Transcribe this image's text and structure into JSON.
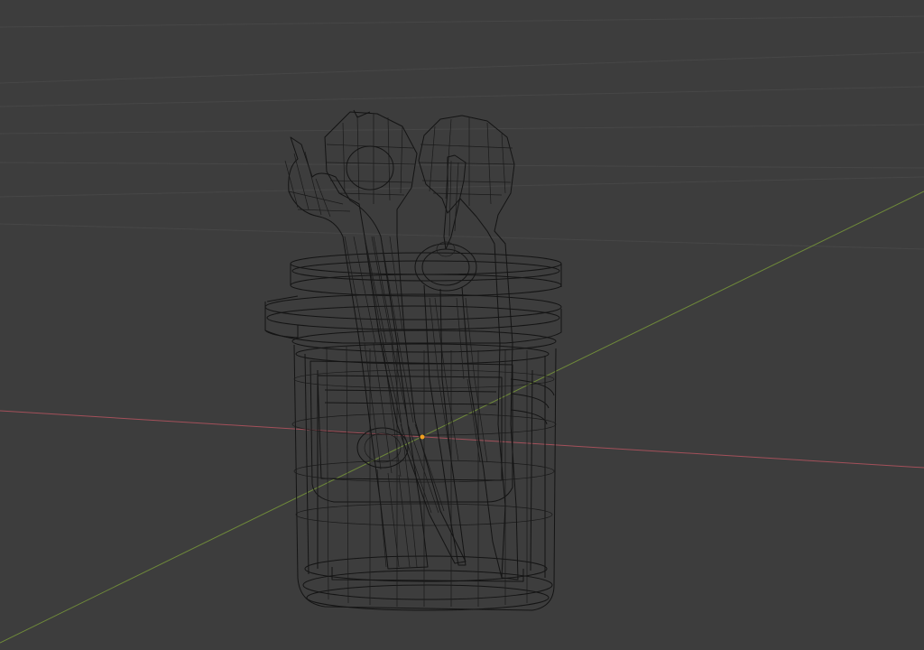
{
  "viewport": {
    "mode": "wireframe",
    "background_color": "#3d3d3d",
    "wire_color": "#141414",
    "x_axis_color": "#a3505a",
    "y_axis_color": "#6f8a3a",
    "origin_color": "#f0a020"
  },
  "scene_objects": [
    {
      "name": "jar",
      "icon": "jar-icon"
    },
    {
      "name": "open-end-wrench",
      "icon": "wrench-icon"
    },
    {
      "name": "ring-spanner",
      "icon": "spanner-icon"
    },
    {
      "name": "pliers",
      "icon": "pliers-icon"
    }
  ]
}
